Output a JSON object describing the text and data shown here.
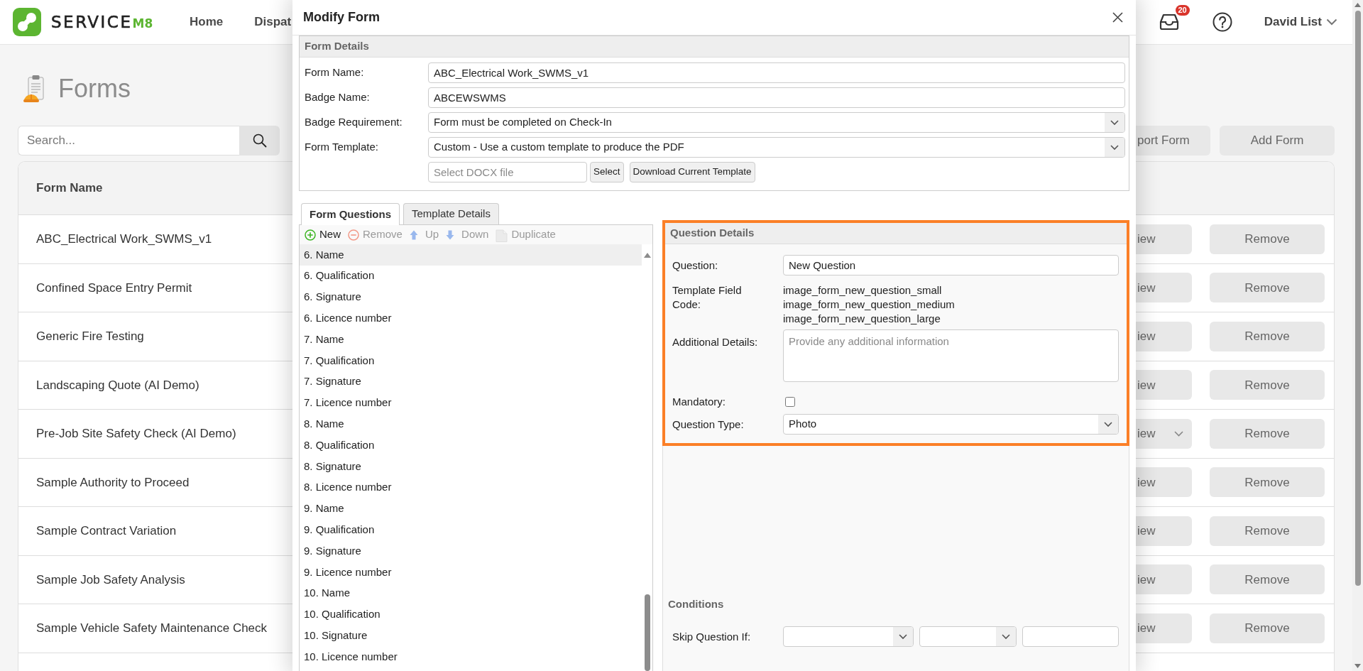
{
  "header": {
    "brand": {
      "name": "SERVICE",
      "suffix": "M8"
    },
    "nav": [
      {
        "label": "Home"
      },
      {
        "label": "Dispat"
      }
    ],
    "inbox_badge": "20",
    "user": "David List"
  },
  "page": {
    "title": "Forms",
    "search": {
      "placeholder": "Search..."
    },
    "actions": [
      {
        "label": "port Form"
      },
      {
        "label": "Add Form"
      }
    ],
    "table": {
      "columns": [
        "Form Name"
      ],
      "rows": [
        {
          "name": "ABC_Electrical Work_SWMS_v1",
          "view": "iew",
          "view_menu": false,
          "remove": "Remove"
        },
        {
          "name": "Confined Space Entry Permit",
          "view": "iew",
          "view_menu": false,
          "remove": "Remove"
        },
        {
          "name": "Generic Fire Testing",
          "view": "iew",
          "view_menu": false,
          "remove": "Remove"
        },
        {
          "name": "Landscaping Quote (AI Demo)",
          "view": "iew",
          "view_menu": false,
          "remove": "Remove"
        },
        {
          "name": "Pre-Job Site Safety Check (AI Demo)",
          "view": "iew",
          "view_menu": true,
          "remove": "Remove"
        },
        {
          "name": "Sample Authority to Proceed",
          "view": "iew",
          "view_menu": false,
          "remove": "Remove"
        },
        {
          "name": "Sample Contract Variation",
          "view": "iew",
          "view_menu": false,
          "remove": "Remove"
        },
        {
          "name": "Sample Job Safety Analysis",
          "view": "iew",
          "view_menu": false,
          "remove": "Remove"
        },
        {
          "name": "Sample Vehicle Safety Maintenance Check",
          "view": "iew",
          "view_menu": false,
          "remove": "Remove"
        }
      ]
    }
  },
  "modal": {
    "title": "Modify Form",
    "form_details": {
      "title": "Form Details",
      "rows": [
        {
          "kind": "text",
          "label": "Form Name:",
          "value": "ABC_Electrical Work_SWMS_v1"
        },
        {
          "kind": "text",
          "label": "Badge Name:",
          "value": "ABCEWSWMS"
        },
        {
          "kind": "select",
          "label": "Badge Requirement:",
          "value": "Form must be completed on Check-In"
        },
        {
          "kind": "select",
          "label": "Form Template:",
          "value": "Custom - Use a custom template to produce the PDF"
        },
        {
          "kind": "file",
          "placeholder": "Select DOCX file",
          "buttons": [
            "Select",
            "Download Current Template"
          ]
        }
      ]
    },
    "tabs": [
      {
        "label": "Form Questions",
        "selected": true
      },
      {
        "label": "Template Details",
        "selected": false
      }
    ],
    "question_toolbar": [
      {
        "kind": "add",
        "label": "New",
        "disabled": false
      },
      {
        "kind": "remove",
        "label": "Remove",
        "disabled": true
      },
      {
        "kind": "up",
        "label": "Up",
        "disabled": true
      },
      {
        "kind": "down",
        "label": "Down",
        "disabled": true
      },
      {
        "kind": "duplicate",
        "label": "Duplicate",
        "disabled": true
      }
    ],
    "questions": [
      {
        "label": "6. Name",
        "selected": false,
        "hovered": true
      },
      {
        "label": "6. Qualification",
        "selected": false,
        "hovered": false
      },
      {
        "label": "6. Signature",
        "selected": false,
        "hovered": false
      },
      {
        "label": "6. Licence number",
        "selected": false,
        "hovered": false
      },
      {
        "label": "7. Name",
        "selected": false,
        "hovered": false
      },
      {
        "label": "7. Qualification",
        "selected": false,
        "hovered": false
      },
      {
        "label": "7. Signature",
        "selected": false,
        "hovered": false
      },
      {
        "label": "7. Licence number",
        "selected": false,
        "hovered": false
      },
      {
        "label": "8. Name",
        "selected": false,
        "hovered": false
      },
      {
        "label": "8. Qualification",
        "selected": false,
        "hovered": false
      },
      {
        "label": "8. Signature",
        "selected": false,
        "hovered": false
      },
      {
        "label": "8. Licence number",
        "selected": false,
        "hovered": false
      },
      {
        "label": "9. Name",
        "selected": false,
        "hovered": false
      },
      {
        "label": "9. Qualification",
        "selected": false,
        "hovered": false
      },
      {
        "label": "9. Signature",
        "selected": false,
        "hovered": false
      },
      {
        "label": "9. Licence number",
        "selected": false,
        "hovered": false
      },
      {
        "label": "10. Name",
        "selected": false,
        "hovered": false
      },
      {
        "label": "10. Qualification",
        "selected": false,
        "hovered": false
      },
      {
        "label": "10. Signature",
        "selected": false,
        "hovered": false
      },
      {
        "label": "10. Licence number",
        "selected": false,
        "hovered": false
      }
    ],
    "question_details": {
      "title": "Question Details",
      "highlighted": true,
      "rows": [
        {
          "kind": "text",
          "label": "Question:",
          "value": "New Question"
        },
        {
          "kind": "codes",
          "label": "Template Field Code:",
          "lines": [
            "image_form_new_question_small",
            "image_form_new_question_medium",
            "image_form_new_question_large"
          ]
        },
        {
          "kind": "textarea",
          "label": "Additional Details:",
          "placeholder": "Provide any additional information"
        },
        {
          "kind": "checkbox",
          "label": "Mandatory:",
          "checked": false
        },
        {
          "kind": "select",
          "label": "Question Type:",
          "value": "Photo"
        }
      ]
    },
    "conditions": {
      "title": "Conditions",
      "rows": [
        {
          "label": "Skip Question If:",
          "fields": [
            {
              "kind": "select"
            },
            {
              "kind": "select"
            },
            {
              "kind": "text"
            }
          ]
        }
      ]
    }
  }
}
